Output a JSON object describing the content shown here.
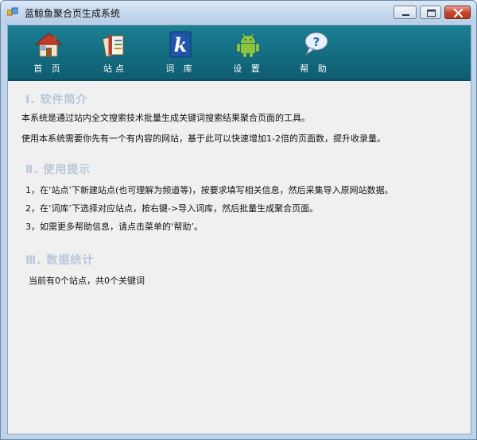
{
  "window": {
    "title": "蓝鲸鱼聚合页生成系统"
  },
  "toolbar": {
    "items": [
      {
        "label": "首 页",
        "icon": "home-icon"
      },
      {
        "label": "站点",
        "icon": "site-books-icon"
      },
      {
        "label": "词 库",
        "icon": "keyword-k-icon"
      },
      {
        "label": "设 置",
        "icon": "android-settings-icon"
      },
      {
        "label": "帮 助",
        "icon": "help-bubble-icon"
      }
    ]
  },
  "sections": {
    "intro": {
      "heading": "Ⅰ. 软件简介",
      "lines": [
        "本系统是通过站内全文搜索技术批量生成关键词搜索结果聚合页面的工具。",
        "使用本系统需要你先有一个有内容的网站，基于此可以快速增加1-2倍的页面数，提升收录量。"
      ]
    },
    "tips": {
      "heading": "Ⅱ. 使用提示",
      "lines": [
        "1，在‘站点’下新建站点(也可理解为频道等)，按要求填写相关信息，然后采集导入原网站数据。",
        "2，在‘词库’下选择对应站点，按右键->导入词库，然后批量生成聚合页面。",
        "3，如需更多帮助信息，请点击菜单的‘帮助’。"
      ]
    },
    "stats": {
      "heading": "Ⅲ. 数据统计",
      "summary": "当前有0个站点，共0个关键词"
    }
  }
}
